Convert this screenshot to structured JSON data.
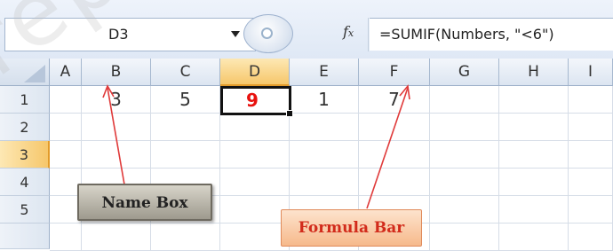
{
  "formula_bar": {
    "name_box_value": "D3",
    "fx_icon": "fx-icon",
    "formula": "=SUMIF(Numbers, \"<6\")"
  },
  "grid": {
    "columns": [
      "A",
      "B",
      "C",
      "D",
      "E",
      "F",
      "G",
      "H",
      "I"
    ],
    "rows": [
      "1",
      "2",
      "3",
      "4",
      "5"
    ],
    "row1_values": {
      "B": "3",
      "C": "5",
      "D": "9",
      "E": "1",
      "F": "7"
    },
    "active_cell": {
      "ref": "D3",
      "value": "9"
    }
  },
  "annotations": {
    "name_box_label": "Name Box",
    "formula_bar_label": "Formula Bar"
  },
  "colors": {
    "selection_header": "#f6c76b",
    "active_value": "#e8120f",
    "formula_callout_text": "#d22b1b"
  },
  "watermark": "rep"
}
